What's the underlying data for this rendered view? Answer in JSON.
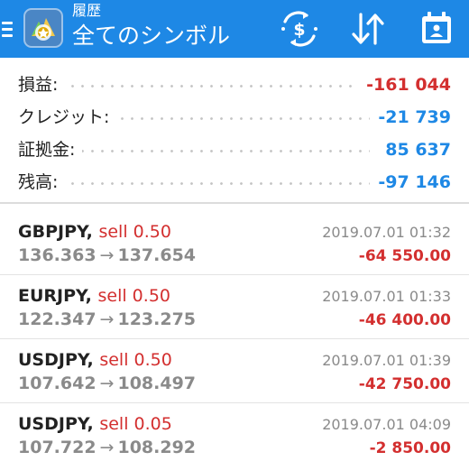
{
  "header": {
    "subtitle": "履歴",
    "title": "全てのシンボル",
    "background_color": "#1e88e5",
    "icons": [
      "menu-icon",
      "app-logo-icon",
      "currency-exchange-icon",
      "sort-icon",
      "calendar-icon"
    ]
  },
  "summary": [
    {
      "label": "損益:",
      "value": "-161 044",
      "color": "#d32f2f"
    },
    {
      "label": "クレジット:",
      "value": "-21 739",
      "color": "#1e88e5"
    },
    {
      "label": "証拠金:",
      "value": "85 637",
      "color": "#1e88e5"
    },
    {
      "label": "残高:",
      "value": "-97 146",
      "color": "#1e88e5"
    }
  ],
  "trades": [
    {
      "symbol": "GBPJPY",
      "type": "sell 0.50",
      "open_price": "136.363",
      "arrow": "→",
      "close_price": "137.654",
      "time": "2019.07.01 01:32",
      "profit": "-64 550.00"
    },
    {
      "symbol": "EURJPY",
      "type": "sell 0.50",
      "open_price": "122.347",
      "arrow": "→",
      "close_price": "123.275",
      "time": "2019.07.01 01:33",
      "profit": "-46 400.00"
    },
    {
      "symbol": "USDJPY",
      "type": "sell 0.50",
      "open_price": "107.642",
      "arrow": "→",
      "close_price": "108.497",
      "time": "2019.07.01 01:39",
      "profit": "-42 750.00"
    },
    {
      "symbol": "USDJPY",
      "type": "sell 0.05",
      "open_price": "107.722",
      "arrow": "→",
      "close_price": "108.292",
      "time": "2019.07.01 04:09",
      "profit": "-2 850.00"
    }
  ],
  "colors": {
    "accent": "#1e88e5",
    "negative": "#d32f2f",
    "muted": "#8a8a8a"
  }
}
